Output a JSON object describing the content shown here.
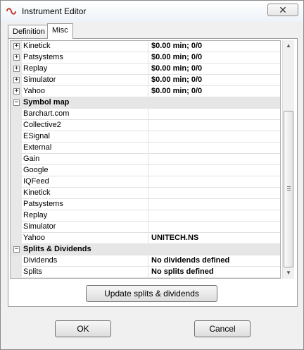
{
  "window": {
    "title": "Instrument Editor",
    "close_glyph": "✕"
  },
  "tabs": [
    {
      "label": "Definition"
    },
    {
      "label": "Misc"
    }
  ],
  "rows": [
    {
      "name": "Kinetick",
      "value": "$0.00 min;  0/0",
      "expander": "+"
    },
    {
      "name": "Patsystems",
      "value": "$0.00 min;  0/0",
      "expander": "+"
    },
    {
      "name": "Replay",
      "value": "$0.00 min;  0/0",
      "expander": "+"
    },
    {
      "name": "Simulator",
      "value": "$0.00 min;  0/0",
      "expander": "+"
    },
    {
      "name": "Yahoo",
      "value": "$0.00 min;  0/0",
      "expander": "+"
    },
    {
      "name": "Symbol map",
      "value": "",
      "expander": "−"
    },
    {
      "name": "Barchart.com",
      "value": ""
    },
    {
      "name": "Collective2",
      "value": ""
    },
    {
      "name": "ESignal",
      "value": ""
    },
    {
      "name": "External",
      "value": ""
    },
    {
      "name": "Gain",
      "value": ""
    },
    {
      "name": "Google",
      "value": ""
    },
    {
      "name": "IQFeed",
      "value": ""
    },
    {
      "name": "Kinetick",
      "value": ""
    },
    {
      "name": "Patsystems",
      "value": ""
    },
    {
      "name": "Replay",
      "value": ""
    },
    {
      "name": "Simulator",
      "value": ""
    },
    {
      "name": "Yahoo",
      "value": "UNITECH.NS"
    },
    {
      "name": "Splits & Dividends",
      "value": "",
      "expander": "−"
    },
    {
      "name": "Dividends",
      "value": "No dividends defined"
    },
    {
      "name": "Splits",
      "value": "No splits defined"
    }
  ],
  "scrollbar": {
    "up_glyph": "▲",
    "down_glyph": "▼"
  },
  "buttons": {
    "update": "Update splits & dividends",
    "ok": "OK",
    "cancel": "Cancel"
  }
}
